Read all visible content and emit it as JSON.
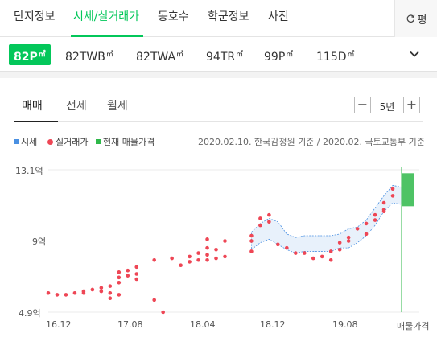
{
  "top_tabs": [
    "단지정보",
    "시세/실거래가",
    "동호수",
    "학군정보",
    "사진"
  ],
  "refresh_label": "평",
  "types": [
    {
      "label": "82P",
      "unit": "㎡"
    },
    {
      "label": "82TWB",
      "unit": "㎡"
    },
    {
      "label": "82TWA",
      "unit": "㎡"
    },
    {
      "label": "94TR",
      "unit": "㎡"
    },
    {
      "label": "99P",
      "unit": "㎡"
    },
    {
      "label": "115D",
      "unit": "㎡"
    }
  ],
  "deal_tabs": [
    "매매",
    "전세",
    "월세"
  ],
  "period": "5년",
  "legend": [
    "시세",
    "실거래가",
    "현재 매물가격"
  ],
  "source": "2020.02.10. 한국감정원 기준 / 2020.02. 국토교통부 기준",
  "colors": {
    "accent": "#03c75a",
    "trade": "#ee4655",
    "band": "#4a90e2",
    "listing": "#2fb84a"
  },
  "chart_data": {
    "type": "scatter",
    "y_unit": "억",
    "ylim": [
      4.9,
      13.1
    ],
    "y_ticks": [
      "13.1억",
      "9억",
      "4.9억"
    ],
    "x_ticks": [
      "16.12",
      "17.08",
      "18.04",
      "18.12",
      "19.08",
      "매물가격"
    ],
    "x_start": "2016-10",
    "x_end": "2020-02",
    "trades": [
      [
        "2016-10",
        6.0
      ],
      [
        "2016-11",
        5.9
      ],
      [
        "2016-12",
        5.9
      ],
      [
        "2017-01",
        6.0
      ],
      [
        "2017-02",
        6.1
      ],
      [
        "2017-02",
        6.0
      ],
      [
        "2017-03",
        6.2
      ],
      [
        "2017-04",
        6.3
      ],
      [
        "2017-04",
        6.1
      ],
      [
        "2017-05",
        6.4
      ],
      [
        "2017-05",
        6.0
      ],
      [
        "2017-05",
        5.7
      ],
      [
        "2017-06",
        6.6
      ],
      [
        "2017-06",
        6.9
      ],
      [
        "2017-06",
        7.2
      ],
      [
        "2017-06",
        5.9
      ],
      [
        "2017-07",
        7.0
      ],
      [
        "2017-07",
        7.3
      ],
      [
        "2017-08",
        7.5
      ],
      [
        "2017-08",
        7.1
      ],
      [
        "2017-08",
        6.8
      ],
      [
        "2017-10",
        7.9
      ],
      [
        "2017-10",
        5.6
      ],
      [
        "2017-11",
        4.9
      ],
      [
        "2017-12",
        8.0
      ],
      [
        "2018-01",
        7.6
      ],
      [
        "2018-02",
        8.1
      ],
      [
        "2018-02",
        7.8
      ],
      [
        "2018-03",
        8.3
      ],
      [
        "2018-03",
        7.9
      ],
      [
        "2018-04",
        8.6
      ],
      [
        "2018-04",
        8.2
      ],
      [
        "2018-04",
        7.9
      ],
      [
        "2018-04",
        9.1
      ],
      [
        "2018-05",
        8.5
      ],
      [
        "2018-05",
        8.0
      ],
      [
        "2018-06",
        9.0
      ],
      [
        "2018-06",
        8.1
      ],
      [
        "2018-09",
        8.4
      ],
      [
        "2018-09",
        9.0
      ],
      [
        "2018-09",
        9.3
      ],
      [
        "2018-10",
        9.9
      ],
      [
        "2018-10",
        10.3
      ],
      [
        "2018-11",
        10.1
      ],
      [
        "2018-11",
        10.5
      ],
      [
        "2018-12",
        8.8
      ],
      [
        "2019-01",
        8.6
      ],
      [
        "2019-02",
        8.3
      ],
      [
        "2019-03",
        8.3
      ],
      [
        "2019-04",
        8.0
      ],
      [
        "2019-05",
        8.1
      ],
      [
        "2019-06",
        7.9
      ],
      [
        "2019-06",
        8.4
      ],
      [
        "2019-07",
        8.9
      ],
      [
        "2019-07",
        8.5
      ],
      [
        "2019-08",
        9.0
      ],
      [
        "2019-08",
        9.2
      ],
      [
        "2019-09",
        9.7
      ],
      [
        "2019-10",
        10.0
      ],
      [
        "2019-10",
        9.4
      ],
      [
        "2019-11",
        10.5
      ],
      [
        "2019-11",
        10.2
      ],
      [
        "2019-12",
        10.8
      ],
      [
        "2019-12",
        11.2
      ],
      [
        "2019-12",
        10.7
      ],
      [
        "2020-01",
        11.6
      ],
      [
        "2020-01",
        12.0
      ]
    ],
    "market_upper": [
      [
        "2018-09",
        9.5
      ],
      [
        "2018-10",
        10.0
      ],
      [
        "2018-11",
        10.3
      ],
      [
        "2018-12",
        10.1
      ],
      [
        "2019-01",
        9.4
      ],
      [
        "2019-02",
        9.2
      ],
      [
        "2019-03",
        9.3
      ],
      [
        "2019-04",
        9.3
      ],
      [
        "2019-05",
        9.3
      ],
      [
        "2019-06",
        9.3
      ],
      [
        "2019-07",
        9.4
      ],
      [
        "2019-08",
        9.7
      ],
      [
        "2019-09",
        9.8
      ],
      [
        "2019-10",
        10.2
      ],
      [
        "2019-11",
        10.9
      ],
      [
        "2019-12",
        11.6
      ],
      [
        "2020-01",
        12.2
      ],
      [
        "2020-02",
        12.1
      ]
    ],
    "market_lower": [
      [
        "2018-09",
        8.5
      ],
      [
        "2018-10",
        8.9
      ],
      [
        "2018-11",
        9.1
      ],
      [
        "2018-12",
        8.8
      ],
      [
        "2019-01",
        8.5
      ],
      [
        "2019-02",
        8.3
      ],
      [
        "2019-03",
        8.4
      ],
      [
        "2019-04",
        8.4
      ],
      [
        "2019-05",
        8.4
      ],
      [
        "2019-06",
        8.4
      ],
      [
        "2019-07",
        8.6
      ],
      [
        "2019-08",
        8.6
      ],
      [
        "2019-09",
        8.9
      ],
      [
        "2019-10",
        9.3
      ],
      [
        "2019-11",
        9.9
      ],
      [
        "2019-12",
        10.7
      ],
      [
        "2020-01",
        11.2
      ],
      [
        "2020-02",
        11.1
      ]
    ],
    "listing_range": [
      11.0,
      12.9
    ],
    "grid": true
  }
}
